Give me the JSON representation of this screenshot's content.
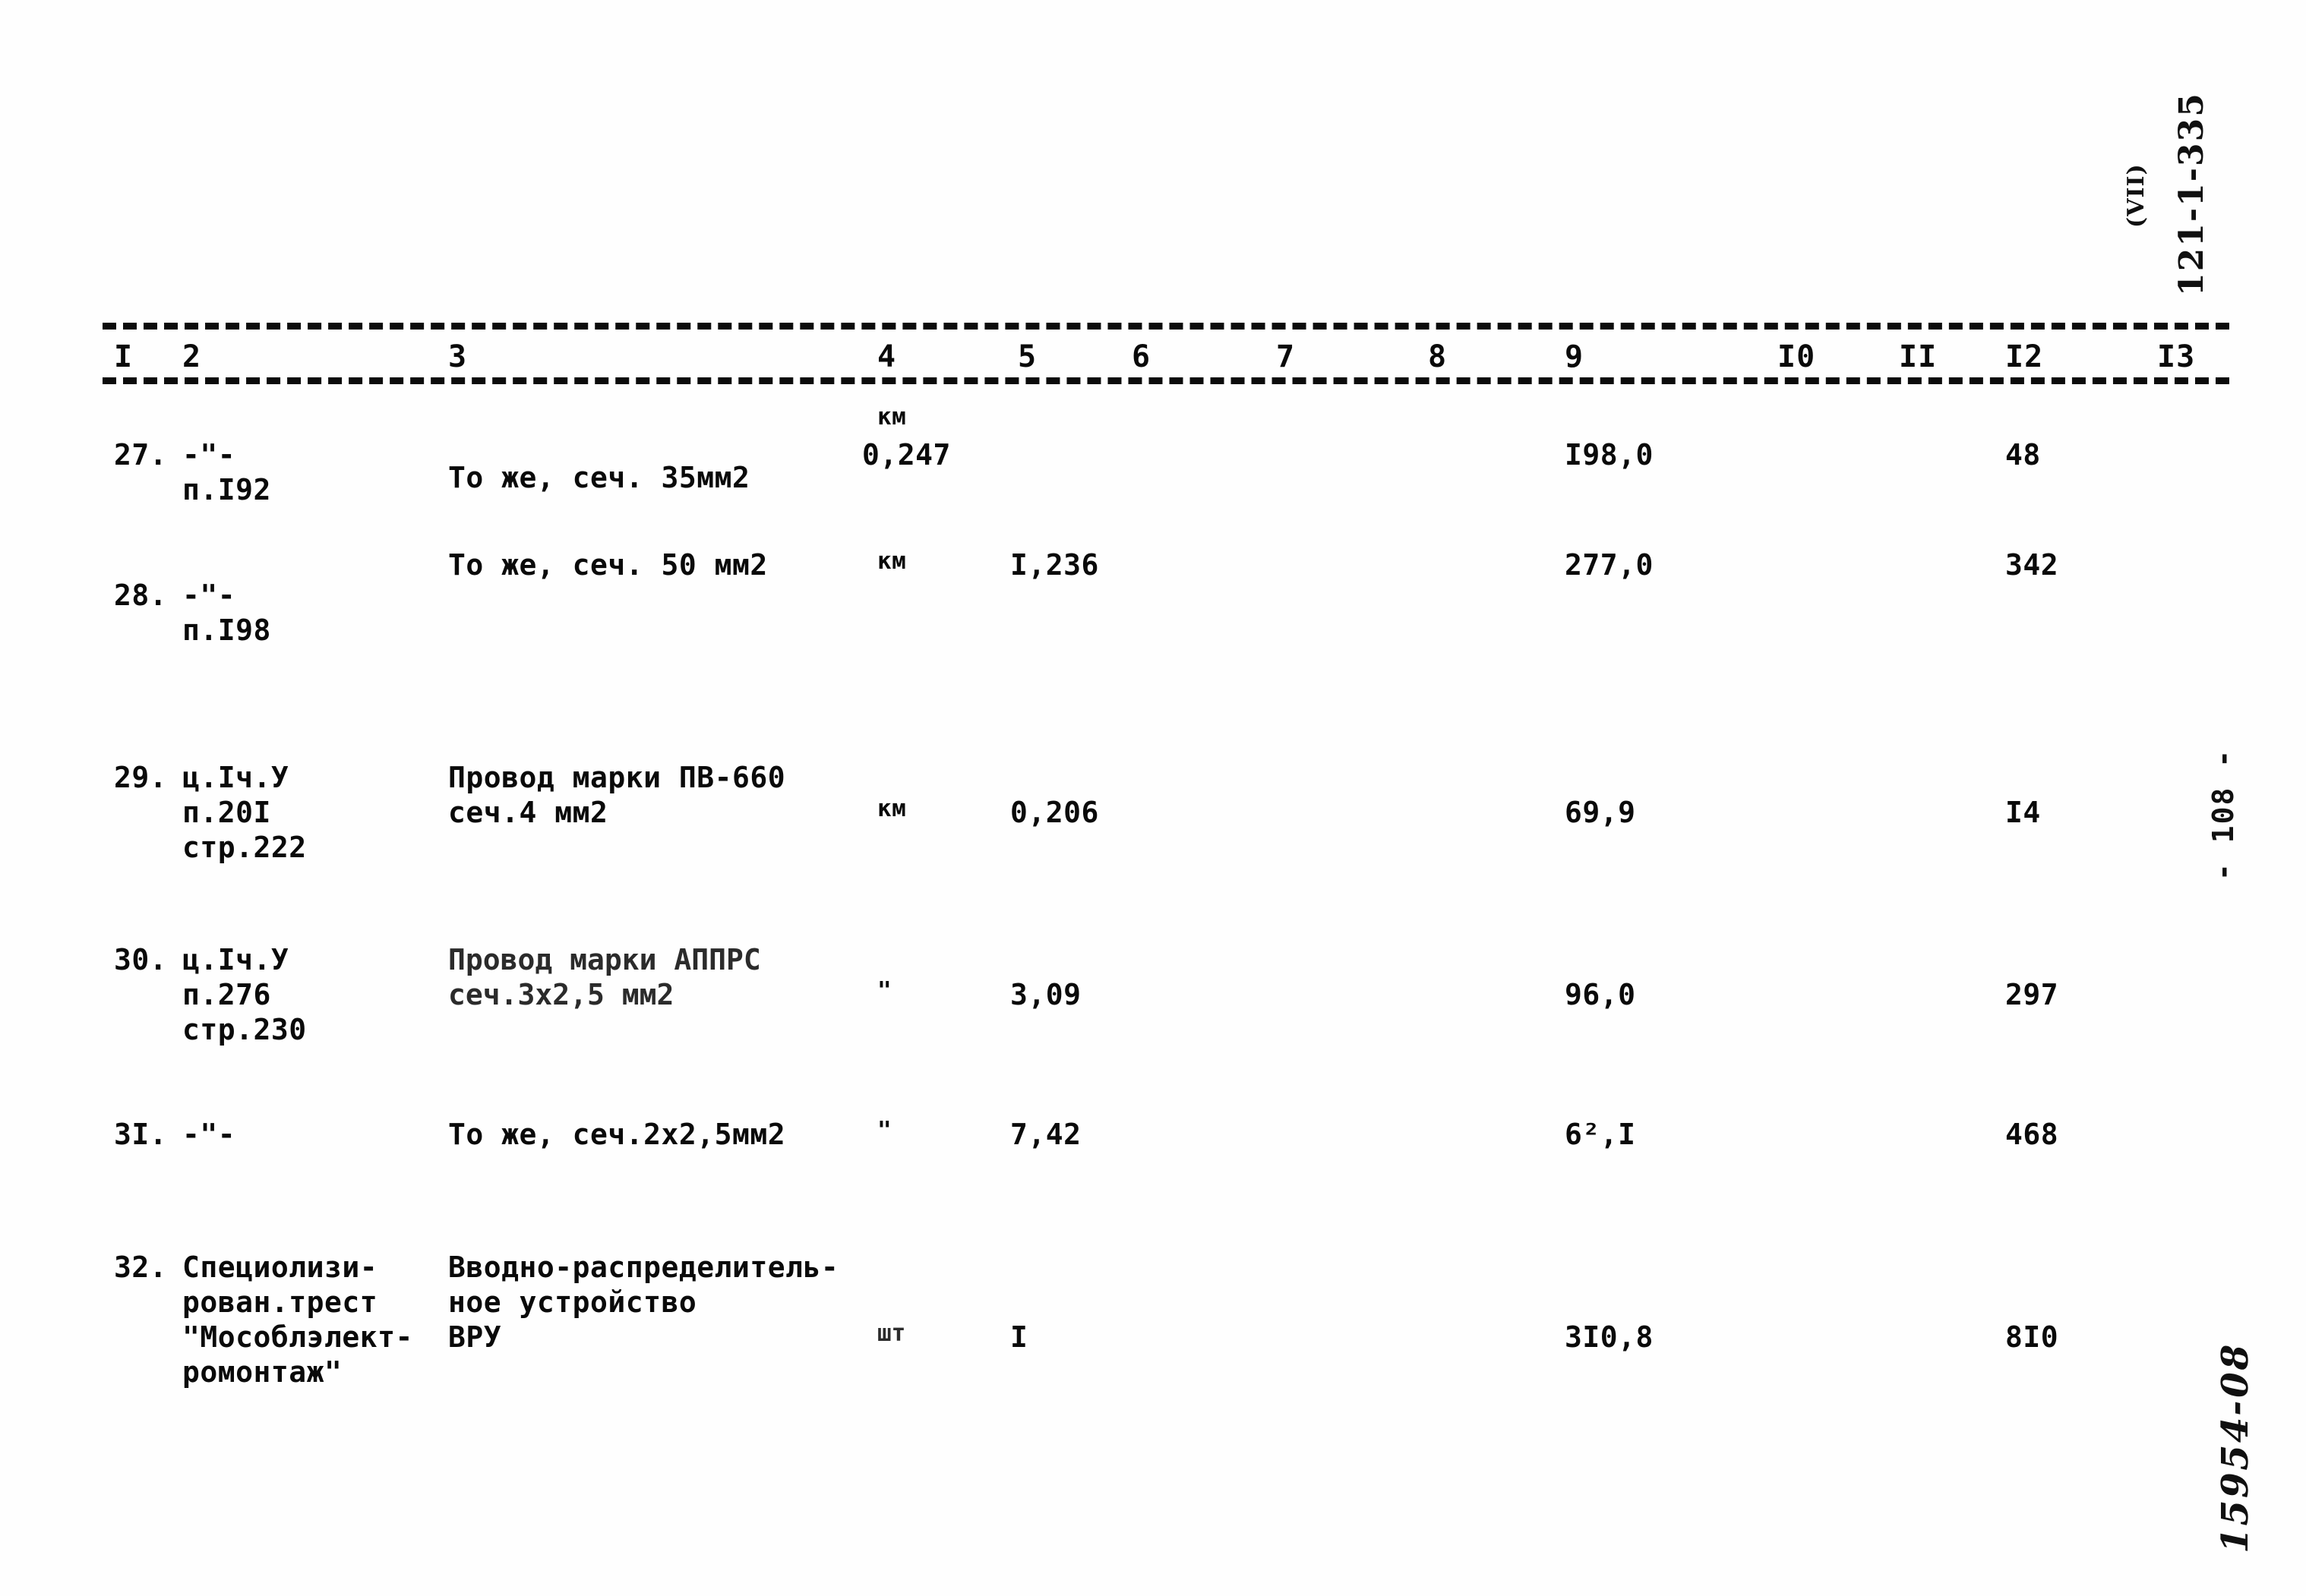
{
  "page": {
    "archive_code": "121-1-335",
    "archive_section": "(VII)",
    "page_number": "- 108 -",
    "inventory_number": "15954-08"
  },
  "table": {
    "column_headers": [
      "I",
      "2",
      "3",
      "4",
      "5",
      "6",
      "7",
      "8",
      "9",
      "I0",
      "II",
      "I2",
      "I3"
    ],
    "rows": [
      {
        "num": "27.",
        "ref_line1": "-\"-",
        "ref_line2": "п.I92",
        "ref_line3": "",
        "desc_line1": "То же, сеч. 35мм2",
        "desc_line2": "",
        "unit": "км",
        "unit_above": true,
        "qty": "0,247",
        "qty_col": 4,
        "c9": "I98,0",
        "c12": "48"
      },
      {
        "num": "28.",
        "ref_line1": "-\"-",
        "ref_line2": "п.I98",
        "ref_line3": "",
        "desc_line1": "То же, сеч. 50 мм2",
        "desc_line2": "",
        "unit": "км",
        "unit_above": false,
        "qty": "I,236",
        "qty_col": 5,
        "c9": "277,0",
        "c12": "342"
      },
      {
        "num": "29.",
        "ref_line1": "ц.Iч.У",
        "ref_line2": "п.20I",
        "ref_line3": "стр.222",
        "desc_line1": "Провод марки ПВ-660",
        "desc_line2": "сеч.4 мм2",
        "unit": "км",
        "unit_above": false,
        "qty": "0,206",
        "qty_col": 5,
        "c9": "69,9",
        "c12": "I4"
      },
      {
        "num": "30.",
        "ref_line1": "ц.Iч.У",
        "ref_line2": "п.276",
        "ref_line3": "стр.230",
        "desc_line1": "Провод марки АППРС",
        "desc_line2": "сеч.3х2,5 мм2",
        "unit": "\"",
        "unit_above": false,
        "qty": "3,09",
        "qty_col": 5,
        "c9": "96,0",
        "c12": "297"
      },
      {
        "num": "3I.",
        "ref_line1": "-\"-",
        "ref_line2": "",
        "ref_line3": "",
        "desc_line1": "То же, сеч.2х2,5мм2",
        "desc_line2": "",
        "unit": "\"",
        "unit_above": false,
        "qty": "7,42",
        "qty_col": 5,
        "c9": "6²,I",
        "c12": "468"
      },
      {
        "num": "32.",
        "ref_line1": "Специолизи-",
        "ref_line2": "рован.трест",
        "ref_line3": "\"Мособлэлект-",
        "ref_line4": "ромонтаж\"",
        "desc_line1": "Вводно-распределитель-",
        "desc_line2": "ное устройство",
        "desc_line3": "ВРУ",
        "unit": "шт",
        "unit_above": false,
        "qty": "I",
        "qty_col": 5,
        "c9": "3I0,8",
        "c12": "8I0"
      }
    ]
  }
}
